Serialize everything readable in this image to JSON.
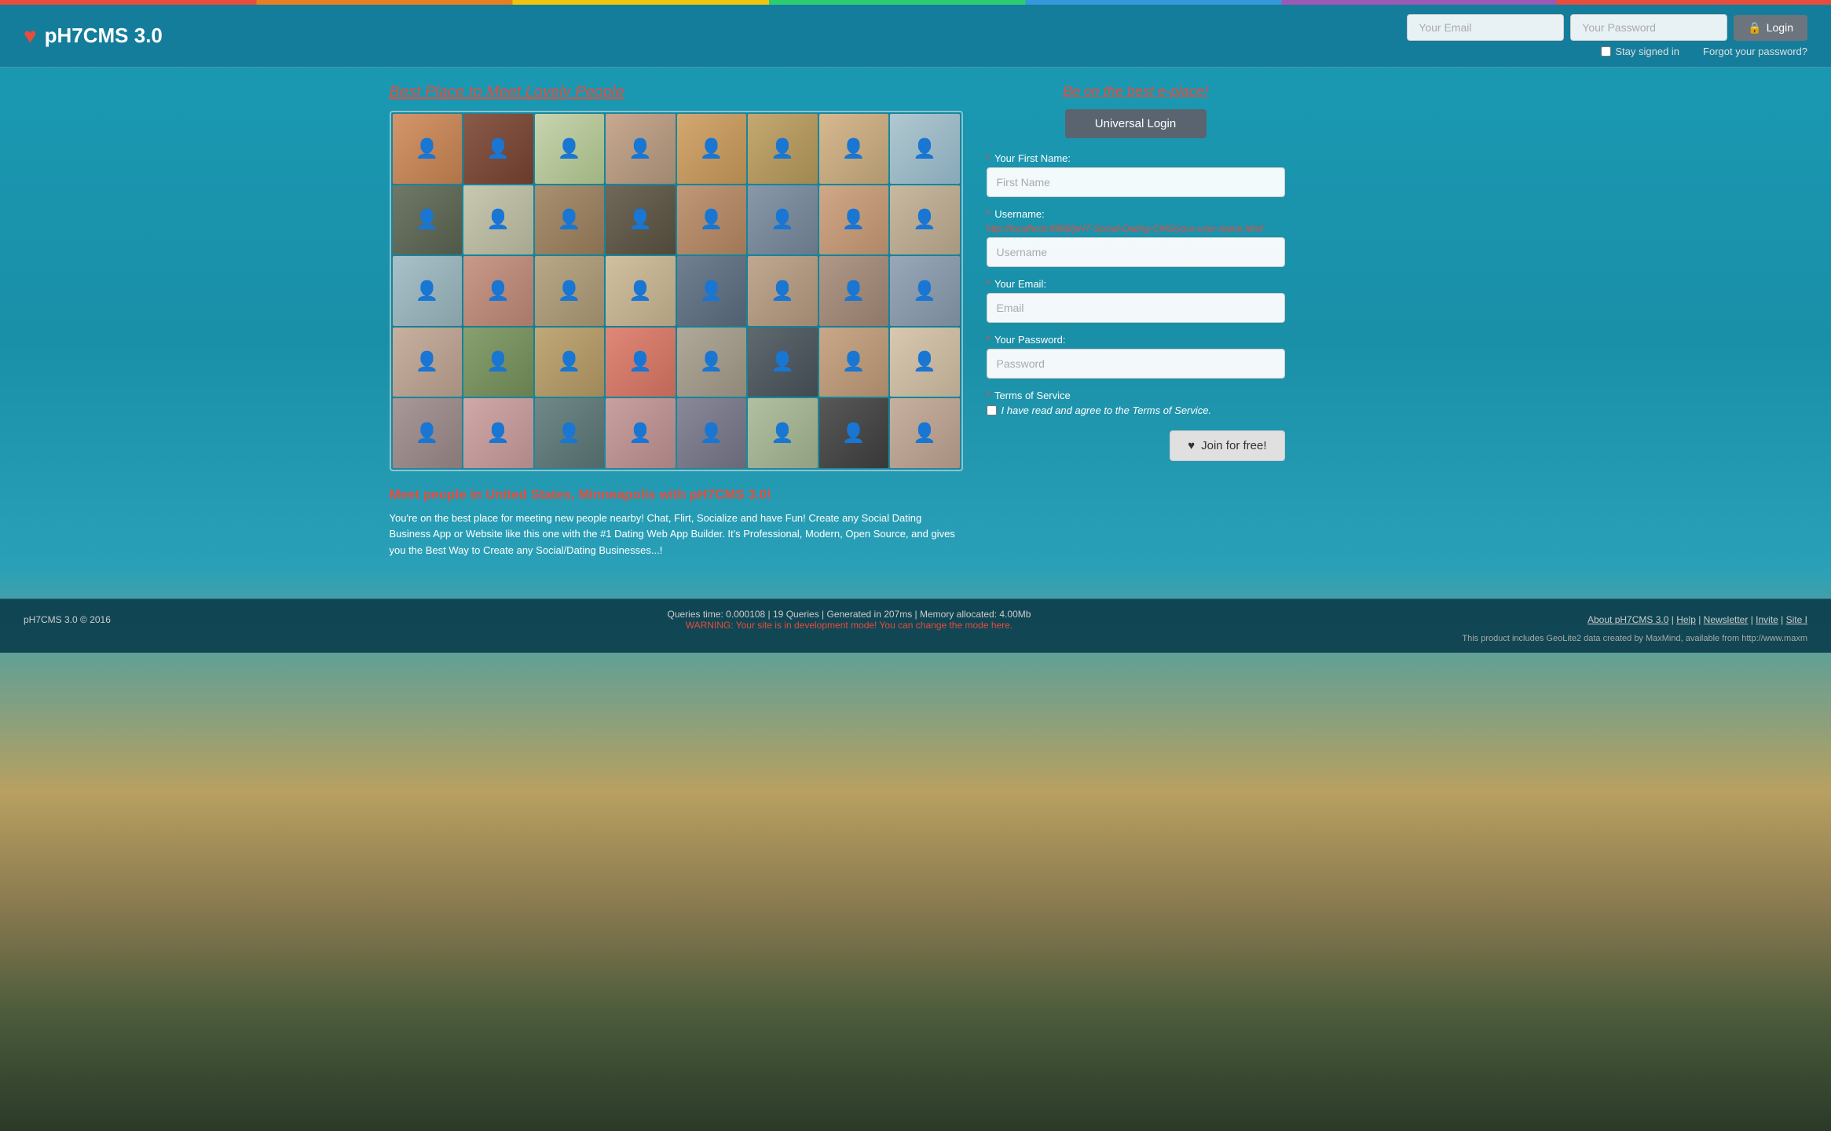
{
  "topBar": {},
  "header": {
    "logo_icon": "♥",
    "logo_text": "pH7CMS 3.0",
    "email_placeholder": "Your Email",
    "password_placeholder": "Your Password",
    "login_label": "Login",
    "lock_icon": "🔒",
    "stay_signed_label": "Stay signed in",
    "forgot_label": "Forgot your password?"
  },
  "leftPanel": {
    "title": "Best Place to Meet Lovely People",
    "location_text": "Meet people in United States, Minneapolis with pH7CMS 3.0!",
    "description": "You're on the best place for meeting new people nearby! Chat, Flirt, Socialize and have Fun! Create any Social Dating Business App or Website like this one with the #1 Dating Web App Builder. It's Professional, Modern, Open Source, and gives you the Best Way to Create any Social/Dating Businesses...!",
    "photos": [
      {
        "id": 1,
        "cls": "fc-1",
        "emoji": "👤"
      },
      {
        "id": 2,
        "cls": "fc-2",
        "emoji": "👤"
      },
      {
        "id": 3,
        "cls": "fc-3",
        "emoji": "👤"
      },
      {
        "id": 4,
        "cls": "fc-4",
        "emoji": "👤"
      },
      {
        "id": 5,
        "cls": "fc-5",
        "emoji": "👤"
      },
      {
        "id": 6,
        "cls": "fc-6",
        "emoji": "👤"
      },
      {
        "id": 7,
        "cls": "fc-7",
        "emoji": "👤"
      },
      {
        "id": 8,
        "cls": "fc-8",
        "emoji": "👤"
      },
      {
        "id": 9,
        "cls": "fc-9",
        "emoji": "👤"
      },
      {
        "id": 10,
        "cls": "fc-10",
        "emoji": "👤"
      },
      {
        "id": 11,
        "cls": "fc-11",
        "emoji": "👤"
      },
      {
        "id": 12,
        "cls": "fc-12",
        "emoji": "👤"
      },
      {
        "id": 13,
        "cls": "fc-13",
        "emoji": "👤"
      },
      {
        "id": 14,
        "cls": "fc-14",
        "emoji": "👤"
      },
      {
        "id": 15,
        "cls": "fc-15",
        "emoji": "👤"
      },
      {
        "id": 16,
        "cls": "fc-16",
        "emoji": "👤"
      },
      {
        "id": 17,
        "cls": "fc-17",
        "emoji": "👤"
      },
      {
        "id": 18,
        "cls": "fc-18",
        "emoji": "👤"
      },
      {
        "id": 19,
        "cls": "fc-19",
        "emoji": "👤"
      },
      {
        "id": 20,
        "cls": "fc-20",
        "emoji": "👤"
      },
      {
        "id": 21,
        "cls": "fc-21",
        "emoji": "👤"
      },
      {
        "id": 22,
        "cls": "fc-22",
        "emoji": "👤"
      },
      {
        "id": 23,
        "cls": "fc-23",
        "emoji": "👤"
      },
      {
        "id": 24,
        "cls": "fc-24",
        "emoji": "👤"
      },
      {
        "id": 25,
        "cls": "fc-25",
        "emoji": "👤"
      },
      {
        "id": 26,
        "cls": "fc-26",
        "emoji": "👤"
      },
      {
        "id": 27,
        "cls": "fc-27",
        "emoji": "👤"
      },
      {
        "id": 28,
        "cls": "fc-28",
        "emoji": "👤"
      },
      {
        "id": 29,
        "cls": "fc-29",
        "emoji": "👤"
      },
      {
        "id": 30,
        "cls": "fc-30",
        "emoji": "👤"
      },
      {
        "id": 31,
        "cls": "fc-31",
        "emoji": "👤"
      },
      {
        "id": 32,
        "cls": "fc-32",
        "emoji": "👤"
      },
      {
        "id": 33,
        "cls": "fc-33",
        "emoji": "👤"
      },
      {
        "id": 34,
        "cls": "fc-34",
        "emoji": "👤"
      },
      {
        "id": 35,
        "cls": "fc-35",
        "emoji": "👤"
      },
      {
        "id": 36,
        "cls": "fc-36",
        "emoji": "👤"
      },
      {
        "id": 37,
        "cls": "fc-37",
        "emoji": "👤"
      },
      {
        "id": 38,
        "cls": "fc-38",
        "emoji": "👤"
      },
      {
        "id": 39,
        "cls": "fc-39",
        "emoji": "👤"
      },
      {
        "id": 40,
        "cls": "fc-40",
        "emoji": "👤"
      }
    ]
  },
  "rightPanel": {
    "be_on_title": "Be on the best e-place!",
    "universal_login_label": "Universal Login",
    "first_name_label": "Your First Name:",
    "first_name_placeholder": "First Name",
    "username_label": "Username:",
    "username_hint_prefix": "http://localhost:8888/pH7-Social-Dating-CMS/",
    "username_hint_var": "your-user-name",
    "username_hint_suffix": ".html",
    "username_placeholder": "Username",
    "email_label": "Your Email:",
    "email_placeholder": "Email",
    "password_label": "Your Password:",
    "password_placeholder": "Password",
    "tos_label": "Terms of Service",
    "tos_check_label": "I have read and agree to the Terms of Service.",
    "join_label": "Join for free!",
    "heart_icon": "♥"
  },
  "footer": {
    "copyright": "pH7CMS 3.0 © 2016",
    "stats": "Queries time: 0.000108 | 19 Queries | Generated in 207ms | Memory allocated: 4.00Mb",
    "warning": "WARNING: Your site is in development mode! You can change the mode here.",
    "links": [
      "About pH7CMS 3.0",
      "Help",
      "Newsletter",
      "Invite",
      "Site I"
    ],
    "geo": "This product includes GeoLite2 data created by MaxMind, available from http://www.maxm"
  }
}
